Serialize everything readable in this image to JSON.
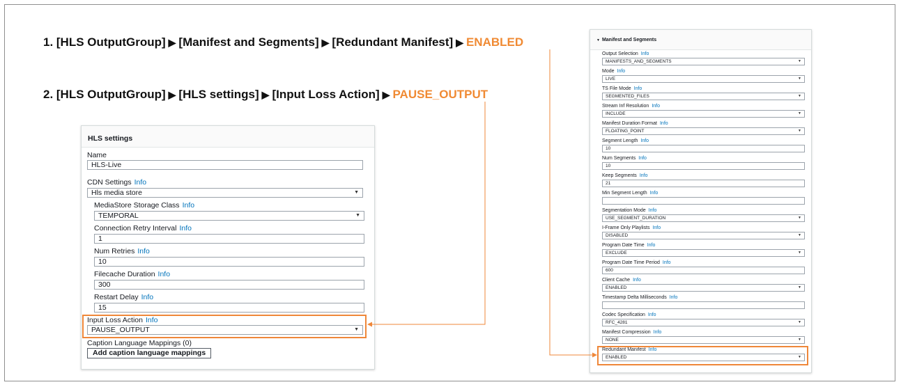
{
  "steps": [
    {
      "text": "1. [HLS OutputGroup]",
      "p2": "[Manifest and Segments]",
      "p3": "[Redundant Manifest]",
      "value": "ENABLED"
    },
    {
      "text": "2. [HLS OutputGroup]",
      "p2": "[HLS settings]",
      "p3": "[Input Loss Action]",
      "value": "PAUSE_OUTPUT"
    }
  ],
  "arrow_glyph": "▶",
  "info_label": "Info",
  "dropdown_glyph": "▼",
  "accent_color": "#f08a33",
  "link_color": "#0073bb",
  "hls_settings": {
    "title": "HLS settings",
    "name_label": "Name",
    "name_value": "HLS-Live",
    "cdn_label": "CDN Settings",
    "cdn_value": "Hls media store",
    "storage_label": "MediaStore Storage Class",
    "storage_value": "TEMPORAL",
    "retry_label": "Connection Retry Interval",
    "retry_value": "1",
    "numretries_label": "Num Retries",
    "numretries_value": "10",
    "filecache_label": "Filecache Duration",
    "filecache_value": "300",
    "restart_label": "Restart Delay",
    "restart_value": "15",
    "inputloss_label": "Input Loss Action",
    "inputloss_value": "PAUSE_OUTPUT",
    "caption_label": "Caption Language Mappings (0)",
    "caption_button": "Add caption language mappings"
  },
  "manifest": {
    "title": "Manifest and Segments",
    "fields": [
      {
        "label": "Output Selection",
        "info": true,
        "value": "MANIFESTS_AND_SEGMENTS",
        "dropdown": true
      },
      {
        "label": "Mode",
        "info": true,
        "value": "LIVE",
        "dropdown": true
      },
      {
        "label": "TS File Mode",
        "info": true,
        "value": "SEGMENTED_FILES",
        "dropdown": true
      },
      {
        "label": "Stream Inf Resolution",
        "info": true,
        "value": "INCLUDE",
        "dropdown": true
      },
      {
        "label": "Manifest Duration Format",
        "info": true,
        "value": "FLOATING_POINT",
        "dropdown": true
      },
      {
        "label": "Segment Length",
        "info": true,
        "value": "10",
        "dropdown": false
      },
      {
        "label": "Num Segments",
        "info": true,
        "value": "10",
        "dropdown": false
      },
      {
        "label": "Keep Segments",
        "info": true,
        "value": "21",
        "dropdown": false
      },
      {
        "label": "Min Segment Length",
        "info": true,
        "value": "",
        "dropdown": false
      },
      {
        "label": "Segmentation Mode",
        "info": true,
        "value": "USE_SEGMENT_DURATION",
        "dropdown": true
      },
      {
        "label": "I-Frame Only Playlists",
        "info": true,
        "value": "DISABLED",
        "dropdown": true
      },
      {
        "label": "Program Date Time",
        "info": true,
        "value": "EXCLUDE",
        "dropdown": true
      },
      {
        "label": "Program Date Time Period",
        "info": true,
        "value": "600",
        "dropdown": false
      },
      {
        "label": "Client Cache",
        "info": true,
        "value": "ENABLED",
        "dropdown": true
      },
      {
        "label": "Timestamp Delta Milliseconds",
        "info": true,
        "value": "",
        "dropdown": false
      },
      {
        "label": "Codec Specification",
        "info": true,
        "value": "RFC_4281",
        "dropdown": true
      },
      {
        "label": "Manifest Compression",
        "info": true,
        "value": "NONE",
        "dropdown": true
      },
      {
        "label": "Redundant Manifest",
        "info": true,
        "value": "ENABLED",
        "dropdown": true
      }
    ]
  }
}
